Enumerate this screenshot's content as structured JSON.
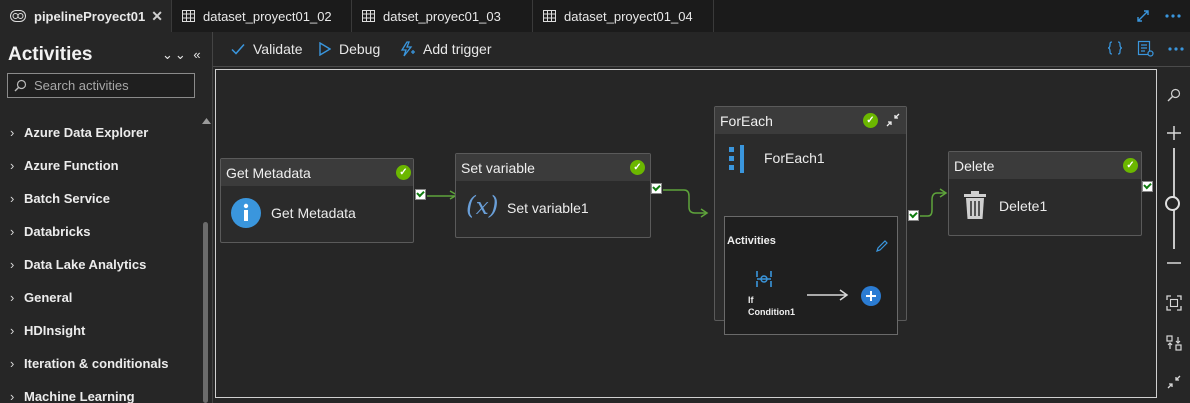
{
  "tabs": [
    {
      "label": "pipelineProyect01",
      "close": "✕"
    },
    {
      "label": "dataset_proyect01_02"
    },
    {
      "label": "datset_proyec01_03"
    },
    {
      "label": "dataset_proyect01_04"
    }
  ],
  "sidebar": {
    "title": "Activities",
    "search_placeholder": "Search activities",
    "categories": [
      "Azure Data Explorer",
      "Azure Function",
      "Batch Service",
      "Databricks",
      "Data Lake Analytics",
      "General",
      "HDInsight",
      "Iteration & conditionals",
      "Machine Learning"
    ]
  },
  "toolbar": {
    "validate": "Validate",
    "debug": "Debug",
    "add_trigger": "Add trigger"
  },
  "pipeline": {
    "get_metadata": {
      "title": "Get Metadata",
      "name": "Get Metadata"
    },
    "set_variable": {
      "title": "Set variable",
      "name": "Set variable1"
    },
    "foreach": {
      "title": "ForEach",
      "name": "ForEach1",
      "inner_title": "Activities",
      "inner_activity_line1": "If",
      "inner_activity_line2": "Condition1"
    },
    "delete": {
      "title": "Delete",
      "name": "Delete1"
    }
  },
  "colors": {
    "accent": "#3a96dd",
    "success": "#6bb700",
    "connector": "#5ea43b"
  }
}
